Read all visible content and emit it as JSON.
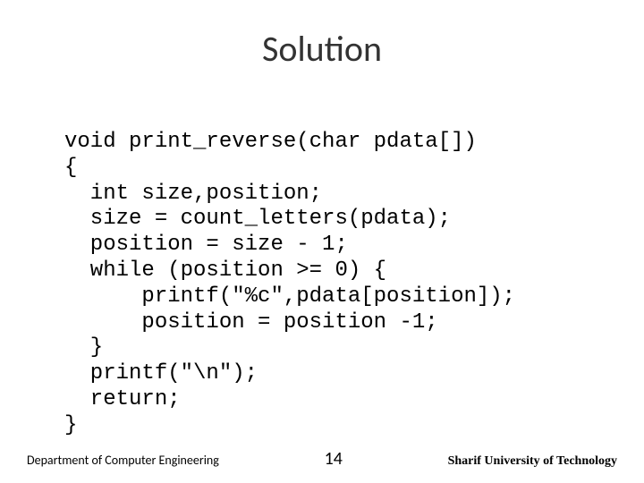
{
  "title": "Solution",
  "code": "void print_reverse(char pdata[])\n{\n  int size,position;\n  size = count_letters(pdata);\n  position = size - 1;\n  while (position >= 0) {\n      printf(\"%c\",pdata[position]);\n      position = position -1;\n  }\n  printf(\"\\n\");\n  return;\n}",
  "footer": {
    "left": "Department of Computer Engineering",
    "page": "14",
    "right": "Sharif University of Technology"
  }
}
